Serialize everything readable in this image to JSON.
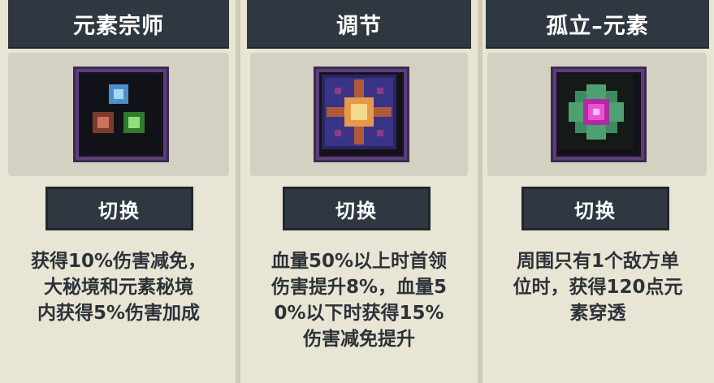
{
  "cards": [
    {
      "title": "元素宗师",
      "icon": "elements-trio-icon",
      "button_label": "切换",
      "description_lines": [
        "获得10%伤害减免，",
        "大秘境和元素秘境",
        "内获得5%伤害加成"
      ]
    },
    {
      "title": "调节",
      "icon": "star-burst-icon",
      "button_label": "切换",
      "description_lines": [
        "血量50%以上时首领",
        "伤害提升8%，血量5",
        "0%以下时获得15%",
        "伤害减免提升"
      ]
    },
    {
      "title": "孤立–元素",
      "icon": "magenta-orb-icon",
      "button_label": "切换",
      "description_lines": [
        "周围只有1个敌方单",
        "位时，获得120点元",
        "素穿透"
      ]
    }
  ],
  "colors": {
    "header_bg": "#2f3840",
    "card_bg": "#e9e5d4",
    "icon_box_bg": "#d4d0c2",
    "text": "#2c3238"
  }
}
